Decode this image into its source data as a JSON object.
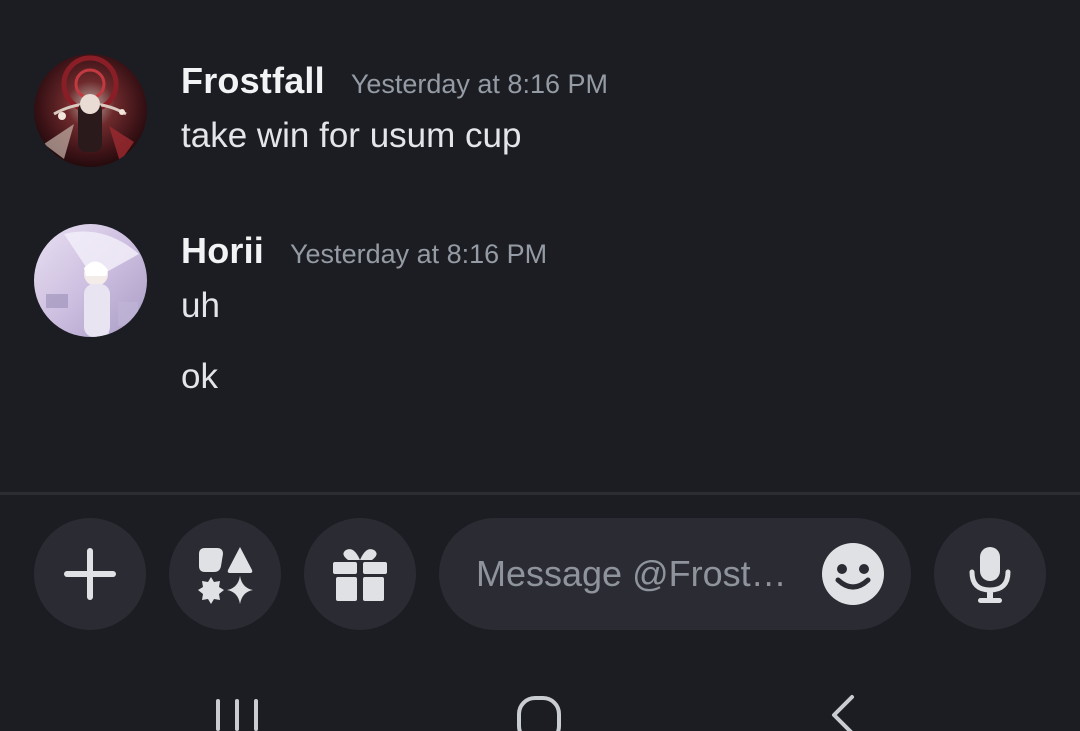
{
  "conversation": {
    "messages": [
      {
        "username": "Frostfall",
        "timestamp": "Yesterday at 8:16 PM",
        "lines": [
          "take win for usum cup"
        ],
        "avatar_icon": "avatar-dark-red-artwork"
      },
      {
        "username": "Horii",
        "timestamp": "Yesterday at 8:16 PM",
        "lines": [
          "uh",
          "ok"
        ],
        "avatar_icon": "avatar-pastel-umbrella-artwork"
      }
    ]
  },
  "composer": {
    "placeholder": "Message @Frost…",
    "buttons": {
      "add": "plus-icon",
      "apps": "apps-shapes-icon",
      "gift": "gift-icon",
      "emoji": "smiley-icon",
      "voice": "microphone-icon"
    }
  },
  "navigation_bar": {
    "recents": "recents-icon",
    "home": "home-icon",
    "back": "back-icon"
  },
  "colors": {
    "background": "#1c1d22",
    "surface": "#2b2c33",
    "text_primary": "#f2f3f5",
    "text_muted": "#949ba4"
  }
}
